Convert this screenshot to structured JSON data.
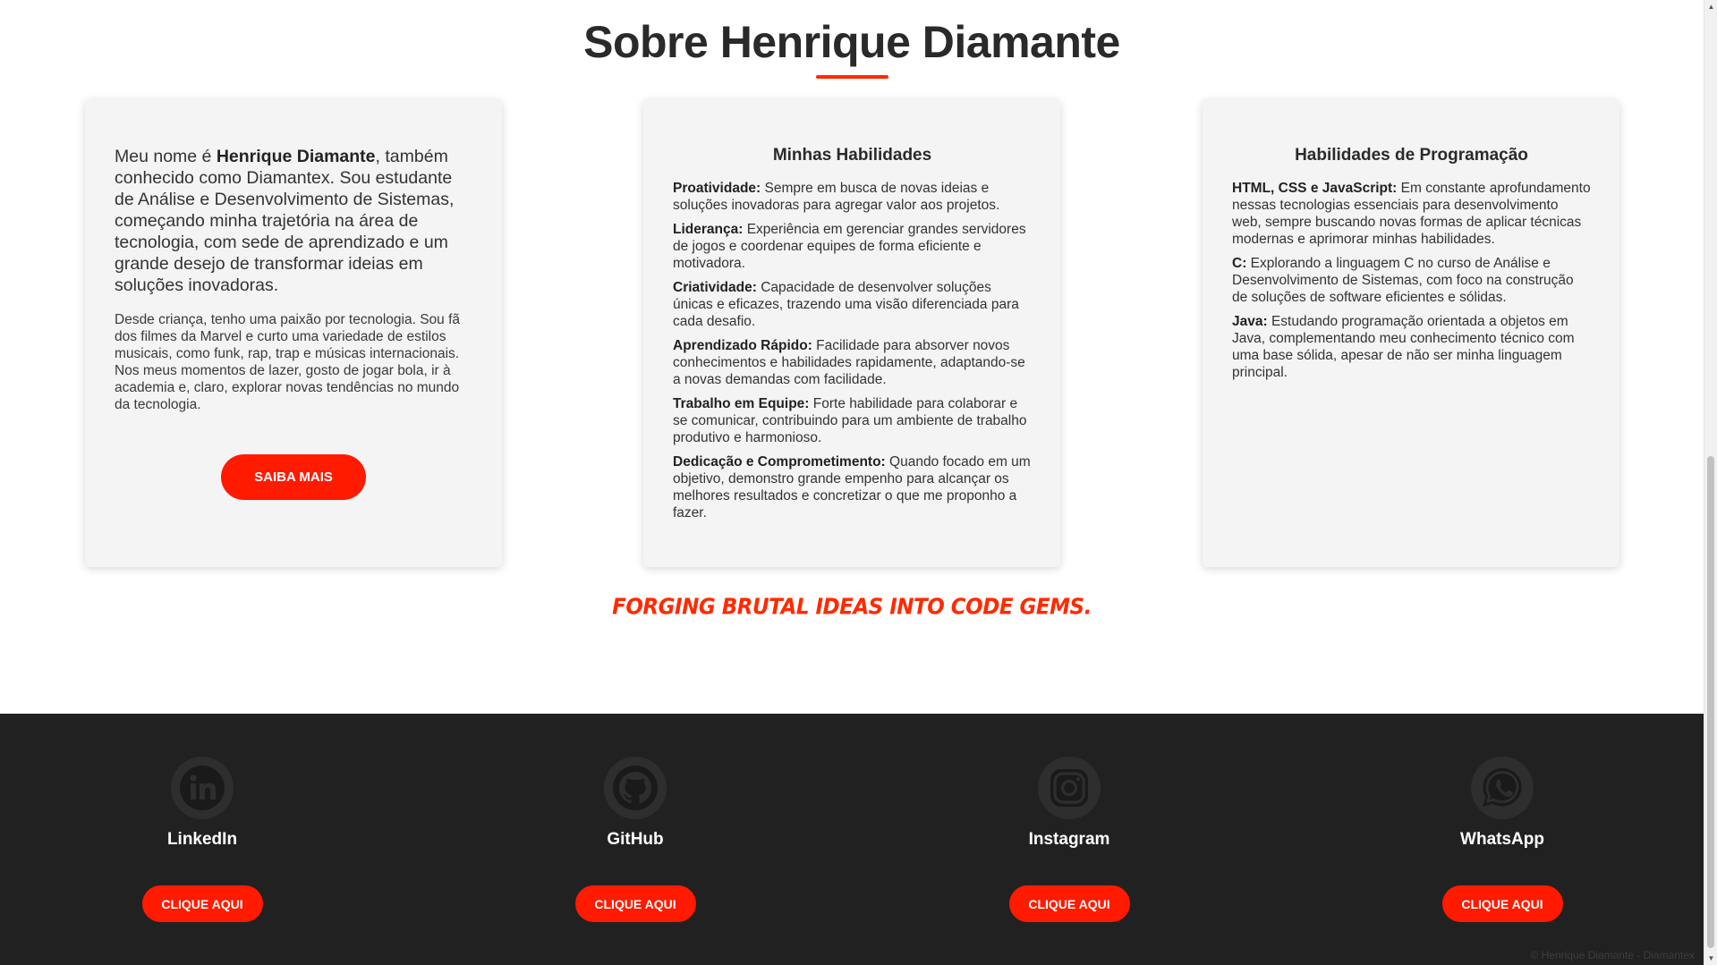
{
  "about": {
    "title": "Sobre Henrique Diamante",
    "intro": {
      "prefix": "Meu nome é ",
      "name": "Henrique Diamante",
      "suffix": ", também conhecido como Diamantex. Sou estudante de Análise e Desenvolvimento de Sistemas, começando minha trajetória na área de tecnologia, com sede de aprendizado e um grande desejo de transformar ideias em soluções inovadoras.",
      "paragraph2": "Desde criança, tenho uma paixão por tecnologia. Sou fã dos filmes da Marvel e curto uma variedade de estilos musicais, como funk, rap, trap e músicas internacionais. Nos meus momentos de lazer, gosto de jogar bola, ir à academia e, claro, explorar novas tendências no mundo da tecnologia.",
      "button_label": "SAIBA MAIS"
    },
    "skills": {
      "heading": "Minhas Habilidades",
      "items": [
        {
          "title": "Proatividade:",
          "text": " Sempre em busca de novas ideias e soluções inovadoras para agregar valor aos projetos."
        },
        {
          "title": "Liderança:",
          "text": " Experiência em gerenciar grandes servidores de jogos e coordenar equipes de forma eficiente e motivadora."
        },
        {
          "title": "Criatividade:",
          "text": " Capacidade de desenvolver soluções únicas e eficazes, trazendo uma visão diferenciada para cada desafio."
        },
        {
          "title": "Aprendizado Rápido:",
          "text": " Facilidade para absorver novos conhecimentos e habilidades rapidamente, adaptando-se a novas demandas com facilidade."
        },
        {
          "title": "Trabalho em Equipe:",
          "text": " Forte habilidade para colaborar e se comunicar, contribuindo para um ambiente de trabalho produtivo e harmonioso."
        },
        {
          "title": "Dedicação e Comprometimento:",
          "text": " Quando focado em um objetivo, demonstro grande empenho para alcançar os melhores resultados e concretizar o que me proponho a fazer."
        }
      ]
    },
    "programming": {
      "heading": "Habilidades de Programação",
      "items": [
        {
          "title": "HTML, CSS e JavaScript:",
          "text": " Em constante aprofundamento nessas tecnologias essenciais para desenvolvimento web, sempre buscando novas formas de aplicar técnicas modernas e aprimorar minhas habilidades."
        },
        {
          "title": "C:",
          "text": " Explorando a linguagem C no curso de Análise e Desenvolvimento de Sistemas, com foco na construção de soluções de software eficientes e sólidas."
        },
        {
          "title": "Java:",
          "text": " Estudando programação orientada a objetos em Java, complementando meu conhecimento técnico com uma base sólida, apesar de não ser minha linguagem principal."
        }
      ]
    },
    "slogan": "FORGING BRUTAL IDEAS INTO CODE GEMS."
  },
  "footer": {
    "socials": [
      {
        "label": "LinkedIn",
        "icon": "linkedin-icon",
        "button": "CLIQUE AQUI"
      },
      {
        "label": "GitHub",
        "icon": "github-icon",
        "button": "CLIQUE AQUI"
      },
      {
        "label": "Instagram",
        "icon": "instagram-icon",
        "button": "CLIQUE AQUI"
      },
      {
        "label": "WhatsApp",
        "icon": "whatsapp-icon",
        "button": "CLIQUE AQUI"
      }
    ],
    "copyright": "© Henrique Diamante - Diamantex"
  },
  "colors": {
    "accent": "#ff1a00",
    "footer_bg": "#212121",
    "card_bg": "#f4f4f4"
  }
}
